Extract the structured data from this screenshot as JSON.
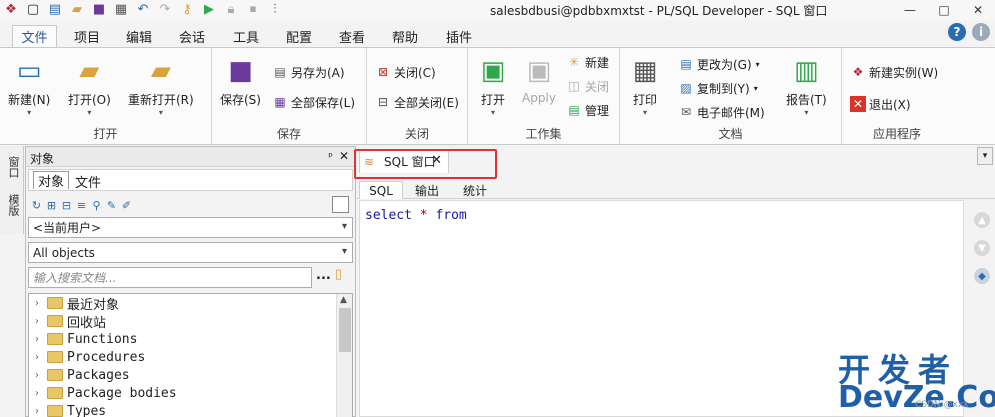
{
  "window": {
    "title": "salesbdbusi@pdbbxmxtst - PL/SQL Developer - SQL 窗口",
    "minimize": "—",
    "maximize": "□",
    "close": "✕"
  },
  "ribbon_tabs": [
    "文件",
    "项目",
    "编辑",
    "会话",
    "工具",
    "配置",
    "查看",
    "帮助",
    "插件"
  ],
  "ribbon": {
    "open_group": {
      "label": "打开",
      "new": "新建(N)",
      "open": "打开(O)",
      "reopen": "重新打开(R)"
    },
    "save_group": {
      "label": "保存",
      "save": "保存(S)",
      "save_as": "另存为(A)",
      "save_all": "全部保存(L)"
    },
    "close_group": {
      "label": "关闭",
      "close": "关闭(C)",
      "close_all": "全部关闭(E)"
    },
    "workset_group": {
      "label": "工作集",
      "open": "打开",
      "apply": "Apply",
      "new": "新建",
      "close": "关闭",
      "manage": "管理"
    },
    "doc_group": {
      "label": "文档",
      "print": "打印",
      "change_to": "更改为(G)",
      "copy_to": "复制到(Y)",
      "email": "电子邮件(M)",
      "report": "报告(T)"
    },
    "app_group": {
      "label": "应用程序",
      "new_instance": "新建实例(W)",
      "exit": "退出(X)"
    }
  },
  "left_strip": {
    "tab1": "窗口",
    "tab2": "模版"
  },
  "object_panel": {
    "title": "对象",
    "pin": "ᵖ",
    "close": "✕",
    "tabs": [
      "对象",
      "文件"
    ],
    "user_combo": "<当前用户>",
    "filter_combo": "All objects",
    "search_placeholder": "输入搜索文档...",
    "search_dots": "...",
    "tree_items": [
      "最近对象",
      "回收站",
      "Functions",
      "Procedures",
      "Packages",
      "Package bodies",
      "Types"
    ]
  },
  "editor": {
    "doc_tab": "SQL 窗口",
    "doc_tab_close": "✕",
    "sub_tabs": [
      "SQL",
      "输出",
      "统计"
    ],
    "code": {
      "kw1": "select",
      "op": "*",
      "kw2": "from"
    }
  },
  "watermark": {
    "cn": "开发者",
    "en": "DevZe.CoM",
    "small": "CSDN @xxx"
  }
}
